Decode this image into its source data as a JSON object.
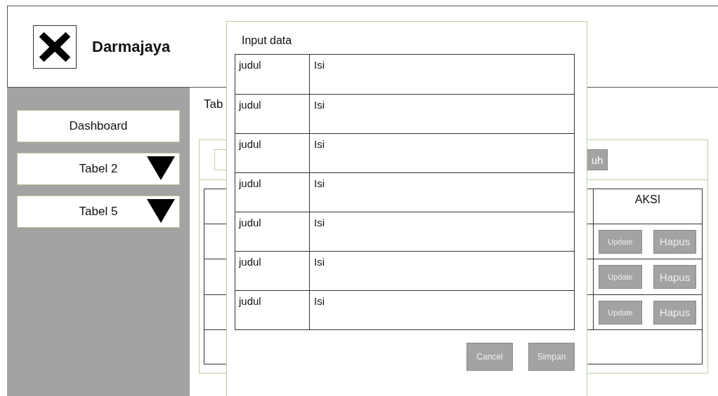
{
  "header": {
    "title": "Darmajaya"
  },
  "sidebar": {
    "items": [
      {
        "label": "Dashboard",
        "kind": "link"
      },
      {
        "label": "Tabel 2",
        "kind": "dropdown"
      },
      {
        "label": "Tabel 5",
        "kind": "dropdown"
      }
    ]
  },
  "content": {
    "title": "Tab",
    "toolbar_button": "uh",
    "table": {
      "action_column": "AKSI",
      "rows": [
        {
          "kind": "actions",
          "update": "Update",
          "delete": "Hapus"
        },
        {
          "kind": "actions",
          "update": "Update",
          "delete": "Hapus"
        },
        {
          "kind": "actions",
          "update": "Update",
          "delete": "Hapus"
        },
        {
          "kind": "empty"
        }
      ]
    }
  },
  "dialog": {
    "title": "Input data",
    "fields": [
      {
        "label": "judul",
        "value": "Isi"
      },
      {
        "label": "judul",
        "value": "Isi"
      },
      {
        "label": "judul",
        "value": "Isi"
      },
      {
        "label": "judul",
        "value": "Isi"
      },
      {
        "label": "judul",
        "value": "Isi"
      },
      {
        "label": "judul",
        "value": "Isi"
      },
      {
        "label": "judul",
        "value": "Isi"
      }
    ],
    "buttons": [
      "Cancel",
      "Simpan"
    ]
  }
}
